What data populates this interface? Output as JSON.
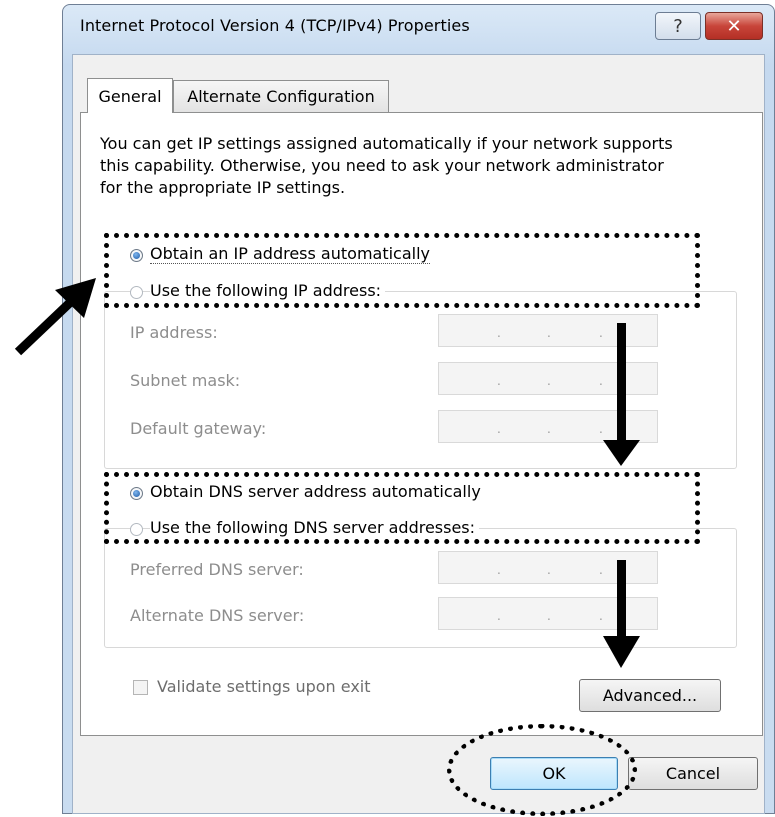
{
  "window": {
    "title": "Internet Protocol Version 4 (TCP/IPv4) Properties",
    "help_glyph": "?",
    "close_glyph": "✕"
  },
  "tabs": [
    {
      "label": "General"
    },
    {
      "label": "Alternate Configuration"
    }
  ],
  "description": {
    "line1": "You can get IP settings assigned automatically if your network supports",
    "line2": "this capability. Otherwise, you need to ask your network administrator",
    "line3": "for the appropriate IP settings."
  },
  "ip": {
    "auto_label": "Obtain an IP address automatically",
    "manual_label": "Use the following IP address:",
    "selected": "auto",
    "fields": [
      {
        "label": "IP address:",
        "value": ". . ."
      },
      {
        "label": "Subnet mask:",
        "value": ". . ."
      },
      {
        "label": "Default gateway:",
        "value": ". . ."
      }
    ]
  },
  "dns": {
    "auto_label": "Obtain DNS server address automatically",
    "manual_label": "Use the following DNS server addresses:",
    "selected": "auto",
    "fields": [
      {
        "label": "Preferred DNS server:",
        "value": ". . ."
      },
      {
        "label": "Alternate DNS server:",
        "value": ". . ."
      }
    ]
  },
  "validate": {
    "label": "Validate settings upon exit",
    "checked": false
  },
  "buttons": {
    "advanced": "Advanced...",
    "ok": "OK",
    "cancel": "Cancel"
  }
}
